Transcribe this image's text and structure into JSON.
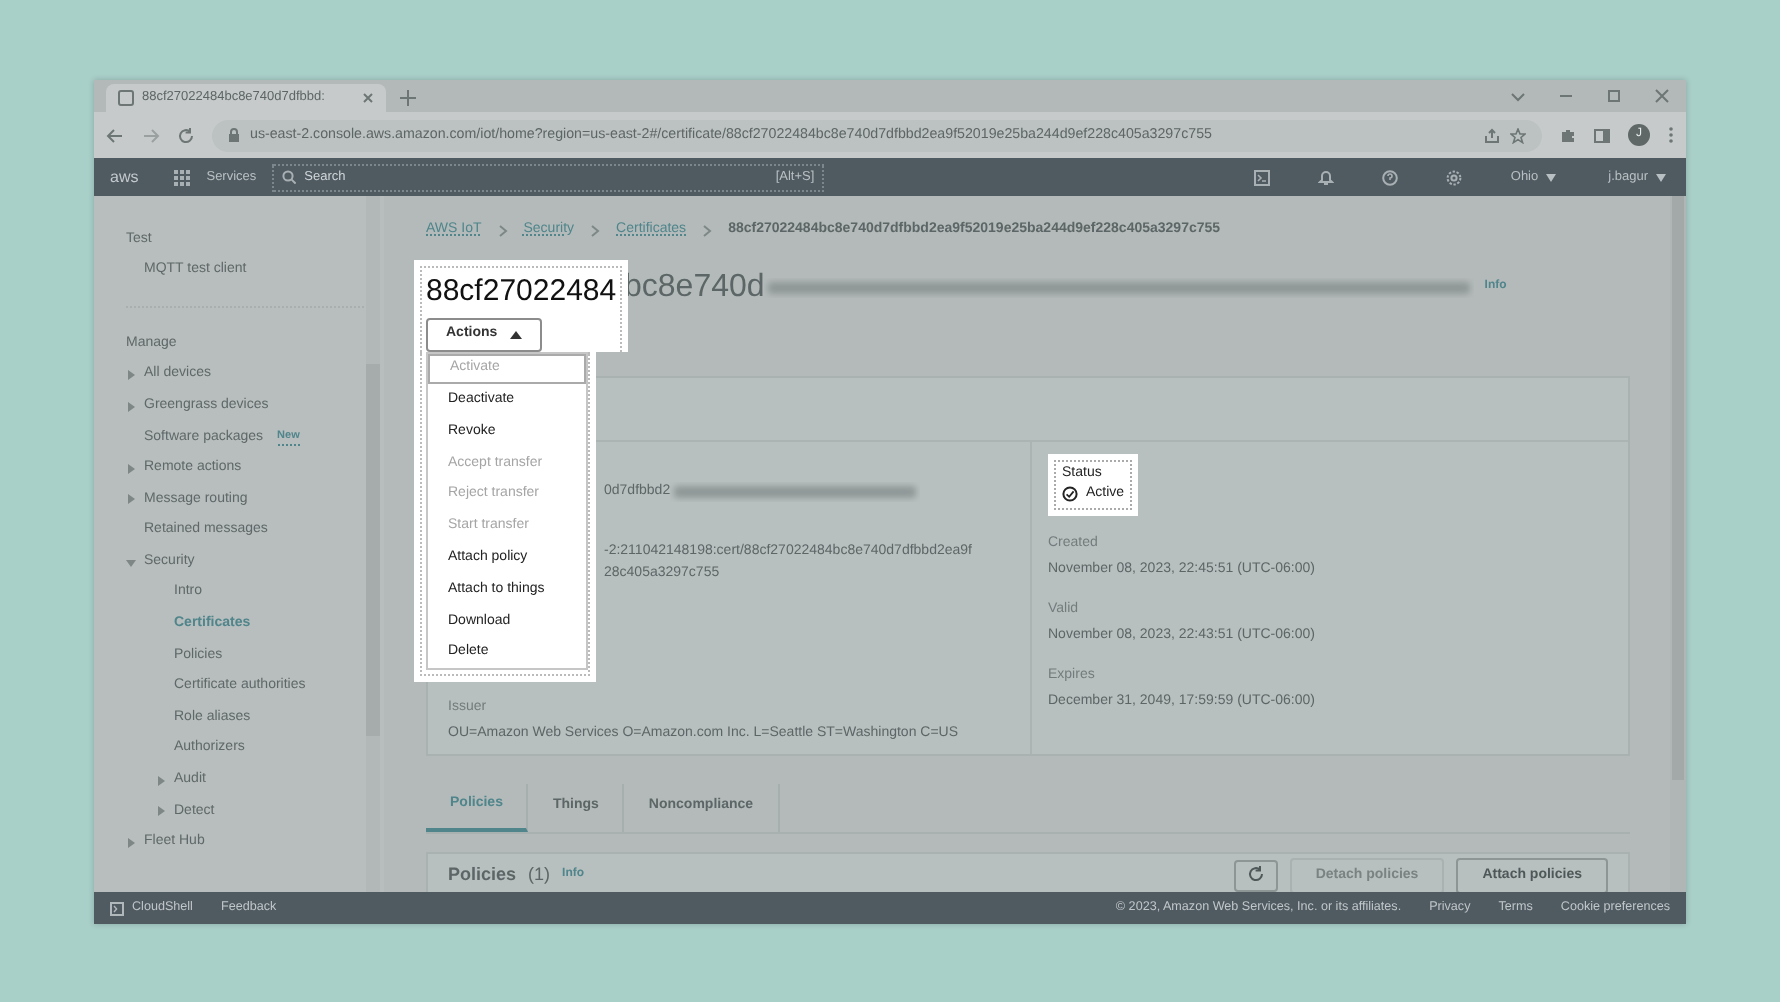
{
  "browser": {
    "tab_title": "88cf27022484bc8e740d7dfbbd:",
    "address": "us-east-2.console.aws.amazon.com/iot/home?region=us-east-2#/certificate/88cf27022484bc8e740d7dfbbd2ea9f52019e25ba244d9ef228c405a3297c755",
    "avatar": "J"
  },
  "console_nav": {
    "logo": "aws",
    "services": "Services",
    "search": {
      "placeholder": "Search",
      "shortcut": "[Alt+S]"
    },
    "region": "Ohio",
    "user": "j.bagur"
  },
  "sidebar": {
    "sections": [
      {
        "heading": "Test",
        "items": [
          {
            "label": "MQTT test client",
            "kind": "link",
            "selected": false
          }
        ]
      },
      {
        "heading": "Manage",
        "items": [
          {
            "label": "All devices",
            "kind": "group",
            "expanded": false,
            "selected": false
          },
          {
            "label": "Greengrass devices",
            "kind": "group",
            "expanded": false,
            "selected": false
          },
          {
            "label": "Software packages",
            "kind": "link",
            "badge": "New",
            "selected": false
          },
          {
            "label": "Remote actions",
            "kind": "group",
            "expanded": false,
            "selected": false
          },
          {
            "label": "Message routing",
            "kind": "group",
            "expanded": false,
            "selected": false
          },
          {
            "label": "Retained messages",
            "kind": "link",
            "selected": false
          },
          {
            "label": "Security",
            "kind": "group",
            "expanded": true,
            "selected": false,
            "children": [
              {
                "label": "Intro",
                "kind": "link",
                "selected": false
              },
              {
                "label": "Certificates",
                "kind": "link",
                "selected": true
              },
              {
                "label": "Policies",
                "kind": "link",
                "selected": false
              },
              {
                "label": "Certificate authorities",
                "kind": "link",
                "selected": false
              },
              {
                "label": "Role aliases",
                "kind": "link",
                "selected": false
              },
              {
                "label": "Authorizers",
                "kind": "link",
                "selected": false
              },
              {
                "label": "Audit",
                "kind": "group",
                "expanded": false,
                "selected": false
              },
              {
                "label": "Detect",
                "kind": "group",
                "expanded": false,
                "selected": false
              }
            ]
          },
          {
            "label": "Fleet Hub",
            "kind": "group",
            "expanded": false,
            "selected": false
          }
        ]
      }
    ]
  },
  "breadcrumb": [
    "AWS IoT",
    "Security",
    "Certificates",
    "88cf27022484bc8e740d7dfbbd2ea9f52019e25ba244d9ef228c405a3297c755"
  ],
  "page_title": {
    "highlighted": "88cf27022484",
    "rest": "bc8e740d",
    "info": "Info"
  },
  "actions": {
    "label": "Actions",
    "expanded": true,
    "items": [
      {
        "label": "Activate",
        "disabled": true,
        "focused": true
      },
      {
        "label": "Deactivate",
        "disabled": false,
        "focused": false
      },
      {
        "label": "Revoke",
        "disabled": false,
        "focused": false
      },
      {
        "label": "Accept transfer",
        "disabled": true,
        "focused": false
      },
      {
        "label": "Reject transfer",
        "disabled": true,
        "focused": false
      },
      {
        "label": "Start transfer",
        "disabled": true,
        "focused": false
      },
      {
        "label": "Attach policy",
        "disabled": false,
        "focused": false
      },
      {
        "label": "Attach to things",
        "disabled": false,
        "focused": false
      },
      {
        "label": "Download",
        "disabled": false,
        "focused": false
      },
      {
        "label": "Delete",
        "disabled": false,
        "focused": false
      }
    ]
  },
  "details": {
    "id_fragment": "0d7dfbbd2",
    "arn_lines": [
      "-2:211042148198:cert/88cf27022484bc8e740d7dfbbd2ea9f",
      "28c405a3297c755"
    ],
    "issuer": {
      "label": "Issuer",
      "value": "OU=Amazon Web Services O=Amazon.com Inc. L=Seattle ST=Washington C=US"
    },
    "status": {
      "label": "Status",
      "value": "Active"
    },
    "dates": [
      {
        "label": "Created",
        "value": "November 08, 2023, 22:45:51 (UTC-06:00)"
      },
      {
        "label": "Valid",
        "value": "November 08, 2023, 22:43:51 (UTC-06:00)"
      },
      {
        "label": "Expires",
        "value": "December 31, 2049, 17:59:59 (UTC-06:00)"
      }
    ]
  },
  "tabs": [
    {
      "label": "Policies",
      "selected": true
    },
    {
      "label": "Things",
      "selected": false
    },
    {
      "label": "Noncompliance",
      "selected": false
    }
  ],
  "policies_panel": {
    "title": "Policies",
    "count": "(1)",
    "info": "Info",
    "buttons": [
      {
        "label": "Detach policies",
        "disabled": true
      },
      {
        "label": "Attach policies",
        "disabled": false
      }
    ]
  },
  "footer": {
    "cloudshell": "CloudShell",
    "feedback": "Feedback",
    "copyright": "© 2023, Amazon Web Services, Inc. or its affiliates.",
    "links": [
      "Privacy",
      "Terms",
      "Cookie preferences"
    ]
  }
}
